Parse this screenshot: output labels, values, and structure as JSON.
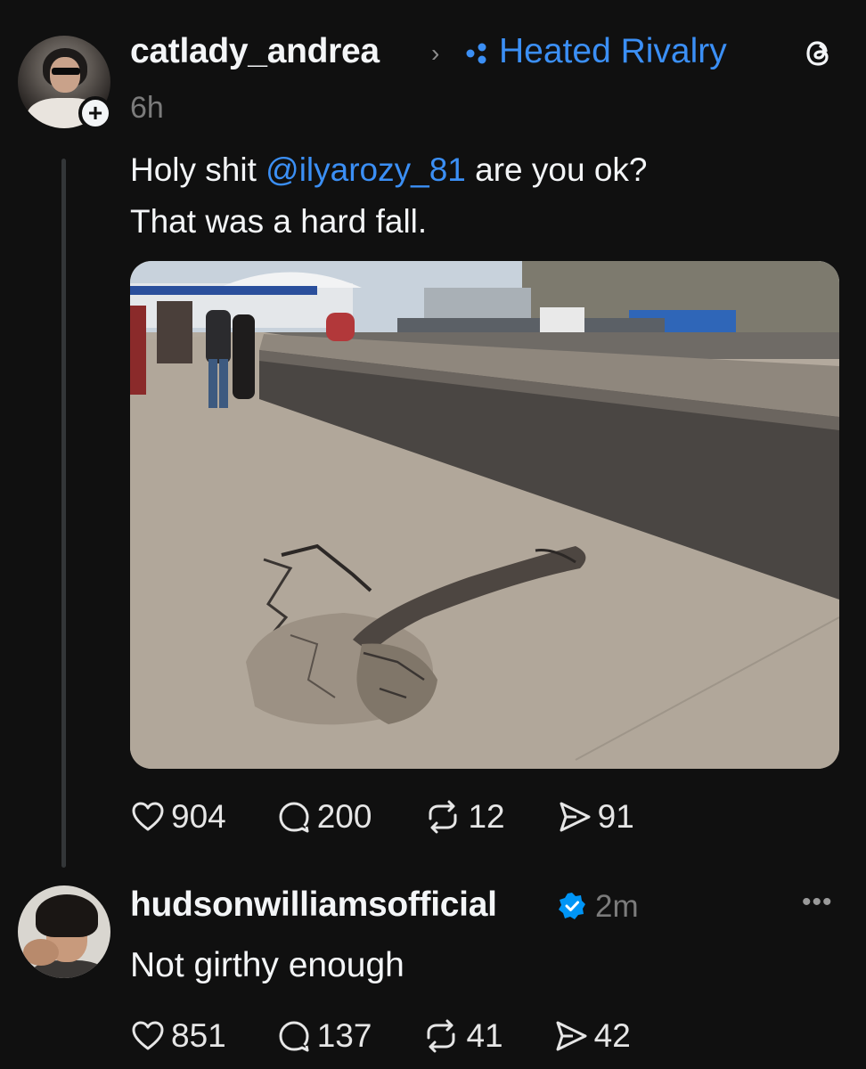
{
  "post": {
    "username": "catlady_andrea",
    "community": "Heated Rivalry",
    "time": "6h",
    "text_before": "Holy shit ",
    "mention": "@ilyarozy_81",
    "text_after": " are you ok?",
    "text_line2": "That was a hard fall.",
    "stats": {
      "likes": "904",
      "replies": "200",
      "reposts": "12",
      "shares": "91"
    }
  },
  "reply": {
    "username": "hudsonwilliamsofficial",
    "time": "2m",
    "text": "Not girthy enough",
    "stats": {
      "likes": "851",
      "replies": "137",
      "reposts": "41",
      "shares": "42"
    }
  },
  "icons": {
    "follow": "plus-icon",
    "community": "community-dots-icon",
    "app": "threads-icon",
    "verified": "verified-badge-icon",
    "more": "more-icon",
    "like": "heart-icon",
    "reply": "comment-icon",
    "repost": "repost-icon",
    "share": "send-icon"
  },
  "colors": {
    "background": "#101010",
    "text": "#f3f5f7",
    "muted": "#7b7b7b",
    "link": "#3b8ff5",
    "verified": "#0095f6"
  }
}
